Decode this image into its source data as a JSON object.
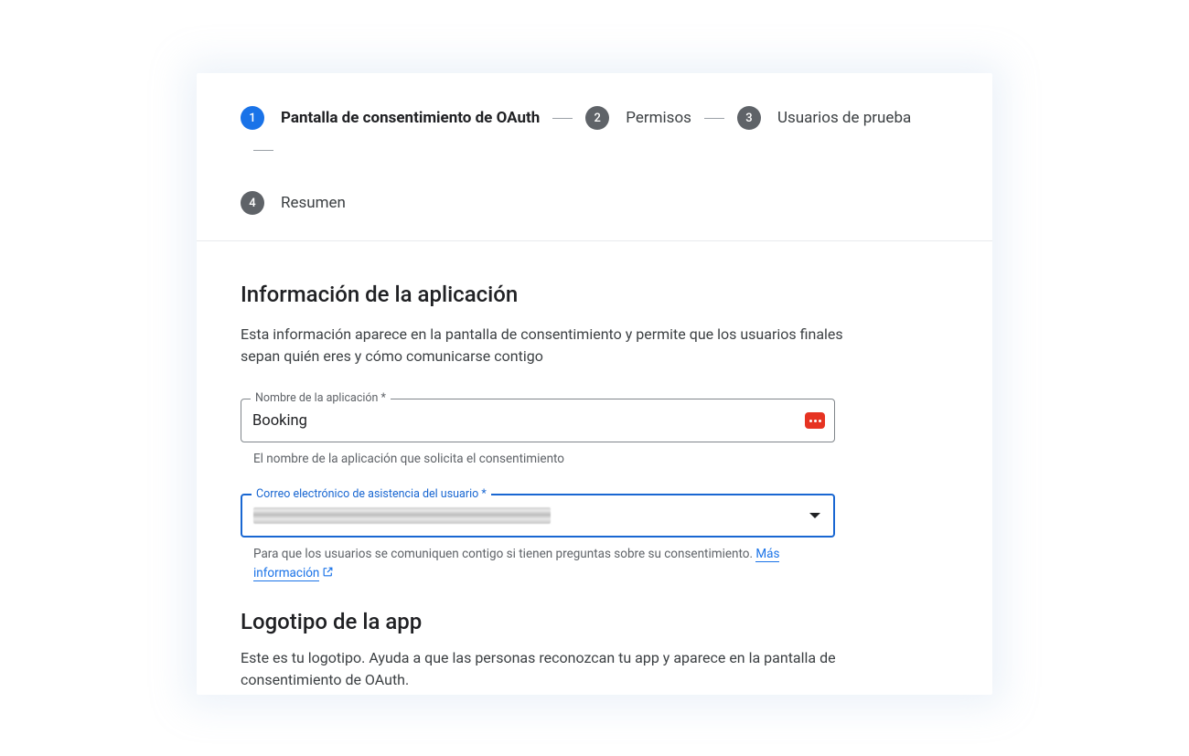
{
  "stepper": {
    "steps": [
      {
        "num": "1",
        "label": "Pantalla de consentimiento de OAuth",
        "active": true
      },
      {
        "num": "2",
        "label": "Permisos",
        "active": false
      },
      {
        "num": "3",
        "label": "Usuarios de prueba",
        "active": false
      },
      {
        "num": "4",
        "label": "Resumen",
        "active": false
      }
    ]
  },
  "appInfo": {
    "title": "Información de la aplicación",
    "desc": "Esta información aparece en la pantalla de consentimiento y permite que los usuarios finales sepan quién eres y cómo comunicarse contigo",
    "nameField": {
      "label": "Nombre de la aplicación *",
      "value": "Booking",
      "help": "El nombre de la aplicación que solicita el consentimiento"
    },
    "emailField": {
      "label": "Correo electrónico de asistencia del usuario *",
      "helpPrefix": "Para que los usuarios se comuniquen contigo si tienen preguntas sobre su consentimiento. ",
      "helpLink": "Más información"
    }
  },
  "logo": {
    "title": "Logotipo de la app",
    "desc": "Este es tu logotipo. Ayuda a que las personas reconozcan tu app y aparece en la pantalla de consentimiento de OAuth."
  }
}
